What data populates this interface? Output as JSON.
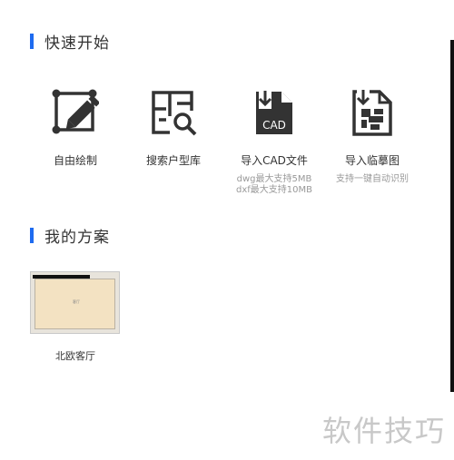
{
  "quick_start": {
    "title": "快速开始",
    "items": [
      {
        "label": "自由绘制",
        "icon": "free-draw-icon"
      },
      {
        "label": "搜索户型库",
        "icon": "floorplan-search-icon"
      },
      {
        "label": "导入CAD文件",
        "icon": "cad-file-import-icon",
        "sub": [
          "dwg最大支持5MB",
          "dxf最大支持10MB"
        ],
        "icon_text": "CAD"
      },
      {
        "label": "导入临摹图",
        "icon": "trace-image-import-icon",
        "sub": [
          "支持一键自动识别"
        ]
      }
    ]
  },
  "my_plans": {
    "title": "我的方案",
    "items": [
      {
        "name": "北欧客厅",
        "room_label": "客厅"
      }
    ]
  },
  "watermark": "软件技巧",
  "colors": {
    "accent": "#1e6bf0",
    "icon": "#333333",
    "subtext": "#999999",
    "floor": "#f3e2c2"
  }
}
